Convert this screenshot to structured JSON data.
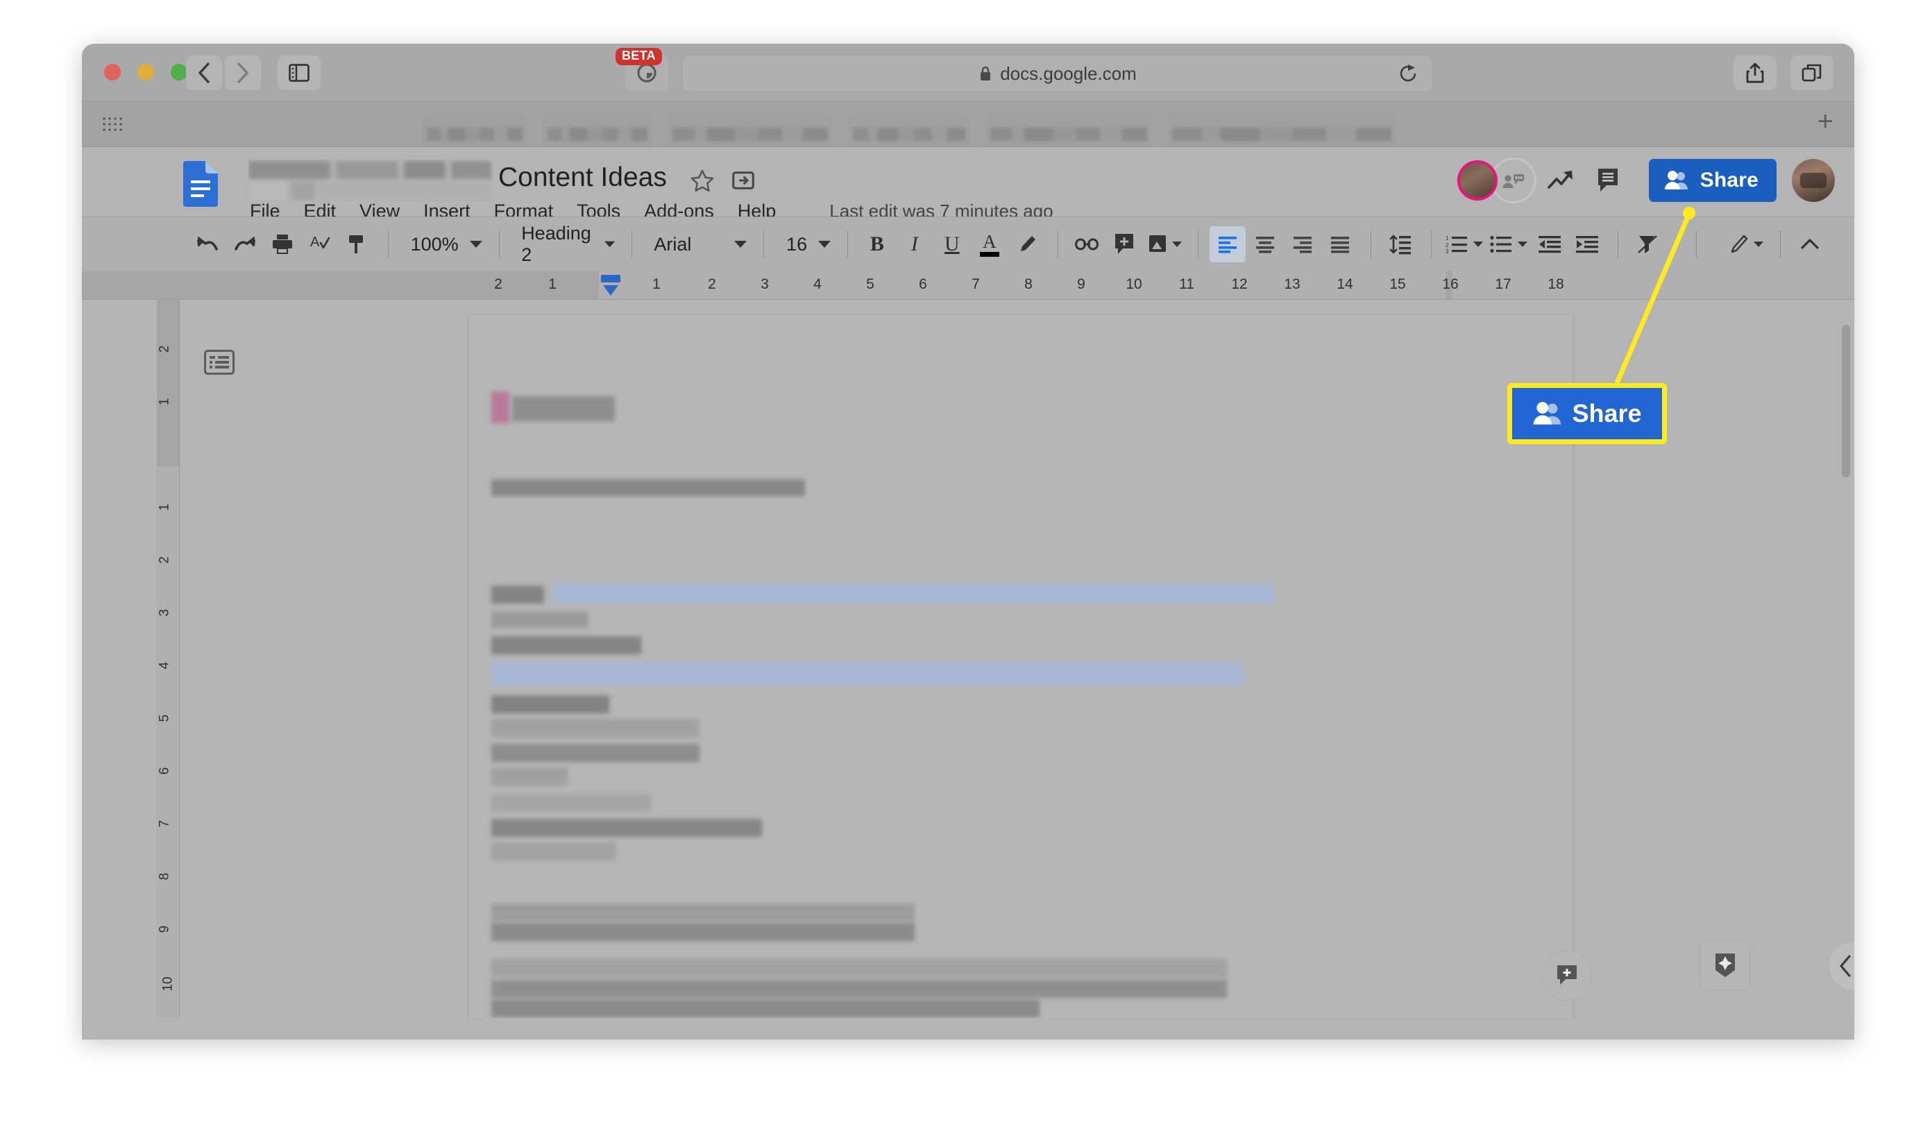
{
  "browser": {
    "url": "docs.google.com",
    "lock_icon": "lock-icon",
    "beta_badge": "BETA",
    "back_icon": "chevron-left-icon",
    "forward_icon": "chevron-right-icon",
    "sidebar_icon": "sidebar-toggle-icon",
    "reload_icon": "reload-icon",
    "share_icon": "share-upload-icon",
    "tabs_icon": "show-all-tabs-icon",
    "new_tab_label": "+",
    "tab_count": 6
  },
  "docs": {
    "title": "Content Ideas",
    "last_edit": "Last edit was 7 minutes ago",
    "logo_icon": "google-docs-logo-icon",
    "star_icon": "star-icon",
    "move_icon": "move-to-folder-icon",
    "menu": [
      {
        "label": "File"
      },
      {
        "label": "Edit"
      },
      {
        "label": "View"
      },
      {
        "label": "Insert"
      },
      {
        "label": "Format"
      },
      {
        "label": "Tools"
      },
      {
        "label": "Add-ons"
      },
      {
        "label": "Help"
      }
    ],
    "header_actions": {
      "collaborator_avatar": "collaborator-avatar",
      "anonymous_viewer_icon": "anonymous-viewer-icon",
      "activity_icon": "activity-dashboard-icon",
      "comments_icon": "comment-history-icon",
      "share_label": "Share",
      "share_icon": "share-people-icon",
      "share_color": "#1a5fc0",
      "account_avatar": "account-avatar"
    },
    "toolbar": {
      "undo_icon": "undo-icon",
      "redo_icon": "redo-icon",
      "print_icon": "print-icon",
      "spelling_icon": "spelling-check-icon",
      "paint_format_icon": "paint-format-icon",
      "zoom_value": "100%",
      "style_value": "Heading 2",
      "font_value": "Arial",
      "size_value": "16",
      "bold_label": "B",
      "italic_label": "I",
      "underline_label": "U",
      "text_color_label": "A",
      "highlight_icon": "highlight-pen-icon",
      "link_icon": "insert-link-icon",
      "comment_icon": "add-comment-icon",
      "image_icon": "insert-image-icon",
      "align_left_icon": "align-left-icon",
      "align_center_icon": "align-center-icon",
      "align_right_icon": "align-right-icon",
      "align_justify_icon": "align-justify-icon",
      "line_spacing_icon": "line-spacing-icon",
      "numbered_list_icon": "numbered-list-icon",
      "bulleted_list_icon": "bulleted-list-icon",
      "decrease_indent_icon": "decrease-indent-icon",
      "increase_indent_icon": "increase-indent-icon",
      "clear_format_icon": "clear-formatting-icon",
      "edit_mode_icon": "edit-mode-pencil-icon",
      "collapse_icon": "collapse-toolbar-icon",
      "dropdown_icon": "chevron-down-icon"
    },
    "ruler": {
      "h_labels": [
        "2",
        "1",
        "1",
        "2",
        "3",
        "4",
        "5",
        "6",
        "7",
        "8",
        "9",
        "10",
        "11",
        "12",
        "13",
        "14",
        "15",
        "16",
        "17",
        "18"
      ],
      "v_labels": [
        "2",
        "1",
        "1",
        "2",
        "3",
        "4",
        "5",
        "6",
        "7",
        "8",
        "9",
        "10"
      ],
      "indent_marker": "indent-marker"
    },
    "canvas": {
      "outline_icon": "document-outline-icon",
      "add_comment_icon": "add-comment-fab-icon",
      "explore_icon": "explore-fab-icon",
      "collapse_panel_icon": "collapse-panel-icon"
    }
  },
  "annotation": {
    "callout_label": "Share",
    "callout_icon": "share-people-icon",
    "border_color": "#ffeb1f",
    "fill_color": "#2266d3",
    "pointer_color": "#ffeb1f"
  }
}
